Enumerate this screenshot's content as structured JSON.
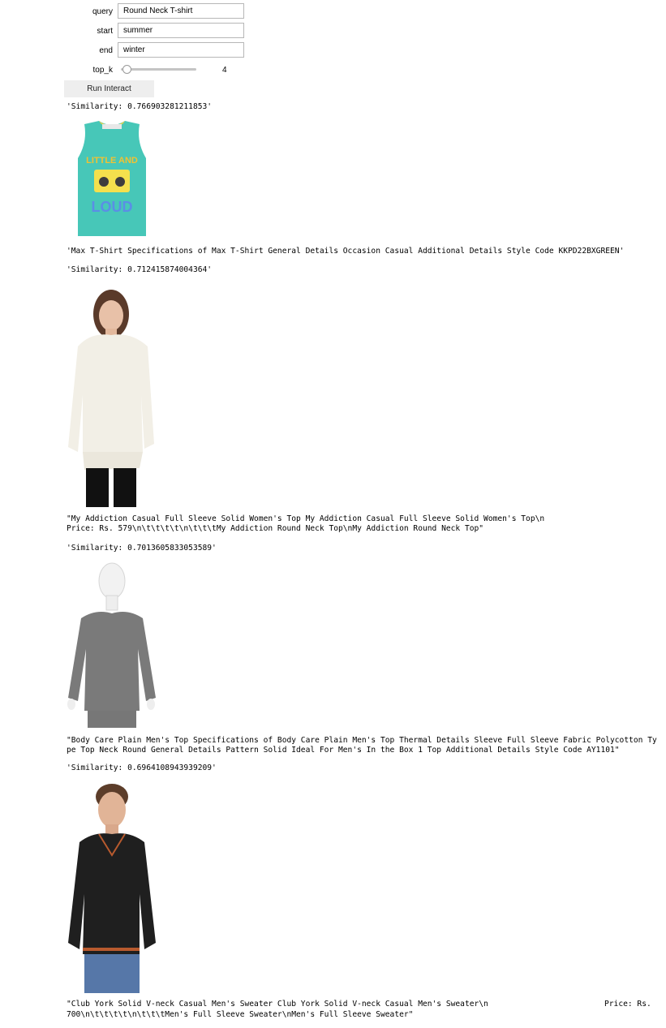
{
  "form": {
    "query_label": "query",
    "query_value": "Round Neck T-shirt",
    "start_label": "start",
    "start_value": "summer",
    "end_label": "end",
    "end_value": "winter",
    "topk_label": "top_k",
    "topk_value": "4",
    "run_button": "Run Interact"
  },
  "results": [
    {
      "similarity": "'Similarity: 0.766903281211853'",
      "image": "teal-sleeveless-tshirt-little-and-loud",
      "description": "'Max T-Shirt Specifications of Max T-Shirt General Details Occasion Casual Additional Details Style Code KKPD22BXGREEN'",
      "shirt_text_1": "LITTLE AND",
      "shirt_text_2": "LOUD"
    },
    {
      "similarity": "'Similarity: 0.712415874004364'",
      "image": "woman-white-full-sleeve-top",
      "description_line1": "\"My Addiction Casual Full Sleeve Solid Women's Top My Addiction Casual Full Sleeve Solid Women's Top\\n",
      "description_line2": "Price: Rs. 579\\n\\t\\t\\t\\t\\n\\t\\t\\tMy Addiction Round Neck Top\\nMy Addiction Round Neck Top\""
    },
    {
      "similarity": "'Similarity: 0.7013605833053589'",
      "image": "grey-thermal-top-on-mannequin",
      "description_line1": "\"Body Care Plain Men's Top Specifications of Body Care Plain Men's Top Thermal Details Sleeve Full Sleeve Fabric Polycotton Ty",
      "description_line2": "pe Top Neck Round General Details Pattern Solid Ideal For Men's In the Box 1 Top Additional Details Style Code AY1101\""
    },
    {
      "similarity": "'Similarity: 0.6964108943939209'",
      "image": "man-black-vneck-sweater",
      "description_line1": "\"Club York Solid V-neck Casual Men's Sweater Club York Solid V-neck Casual Men's Sweater\\n",
      "description_price": "Price: Rs.",
      "description_line2": "700\\n\\t\\t\\t\\t\\n\\t\\t\\tMen's Full Sleeve Sweater\\nMen's Full Sleeve Sweater\""
    }
  ],
  "colors": {
    "teal": "#47c7b8",
    "input_border": "#b7b7b7",
    "button_bg": "#eeeeee"
  }
}
